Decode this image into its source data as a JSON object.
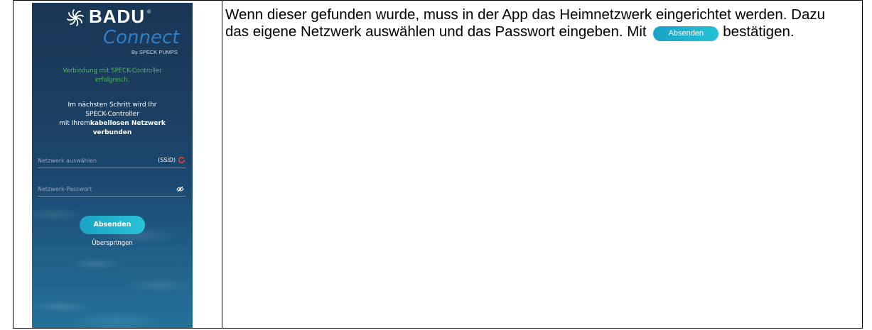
{
  "phone": {
    "brand_name": "BADU",
    "brand_reg": "®",
    "brand_sub": "Connect",
    "brand_by": "By SPECK PUMPS",
    "connection_status_line1": "Verbindung mit SPECK-Controller",
    "connection_status_line2": "erfolgreich.",
    "next_step_line1": "Im nächsten Schritt wird Ihr",
    "next_step_line2": "SPECK-Controller",
    "next_step_line3_prefix": "mit Ihrem",
    "next_step_line3_bold": "kabellosen Netzwerk",
    "next_step_line4": "verbunden",
    "network_field_label": "Netzwerk auswählen",
    "network_ssid_label": "(SSID)",
    "password_field_label": "Netzwerk-Passwort",
    "submit_button": "Absenden",
    "skip_link": "Überspringen",
    "icons": {
      "logo": "badu-swirl-logo-icon",
      "refresh": "refresh-icon",
      "eye": "eye-slash-icon"
    },
    "colors": {
      "background_top": "#1a3656",
      "background_bottom": "#25719a",
      "status_green": "#4cbb5c",
      "button_teal": "#1aa3c7",
      "refresh_red": "#e0403c"
    }
  },
  "instruction": {
    "text_before": "Wenn dieser gefunden wurde, muss in der App das Heimnetzwerk eingerichtet werden. Dazu das eigene Netzwerk auswählen und das Passwort eingeben. Mit",
    "inline_button": "Absenden",
    "text_after": "bestätigen."
  }
}
